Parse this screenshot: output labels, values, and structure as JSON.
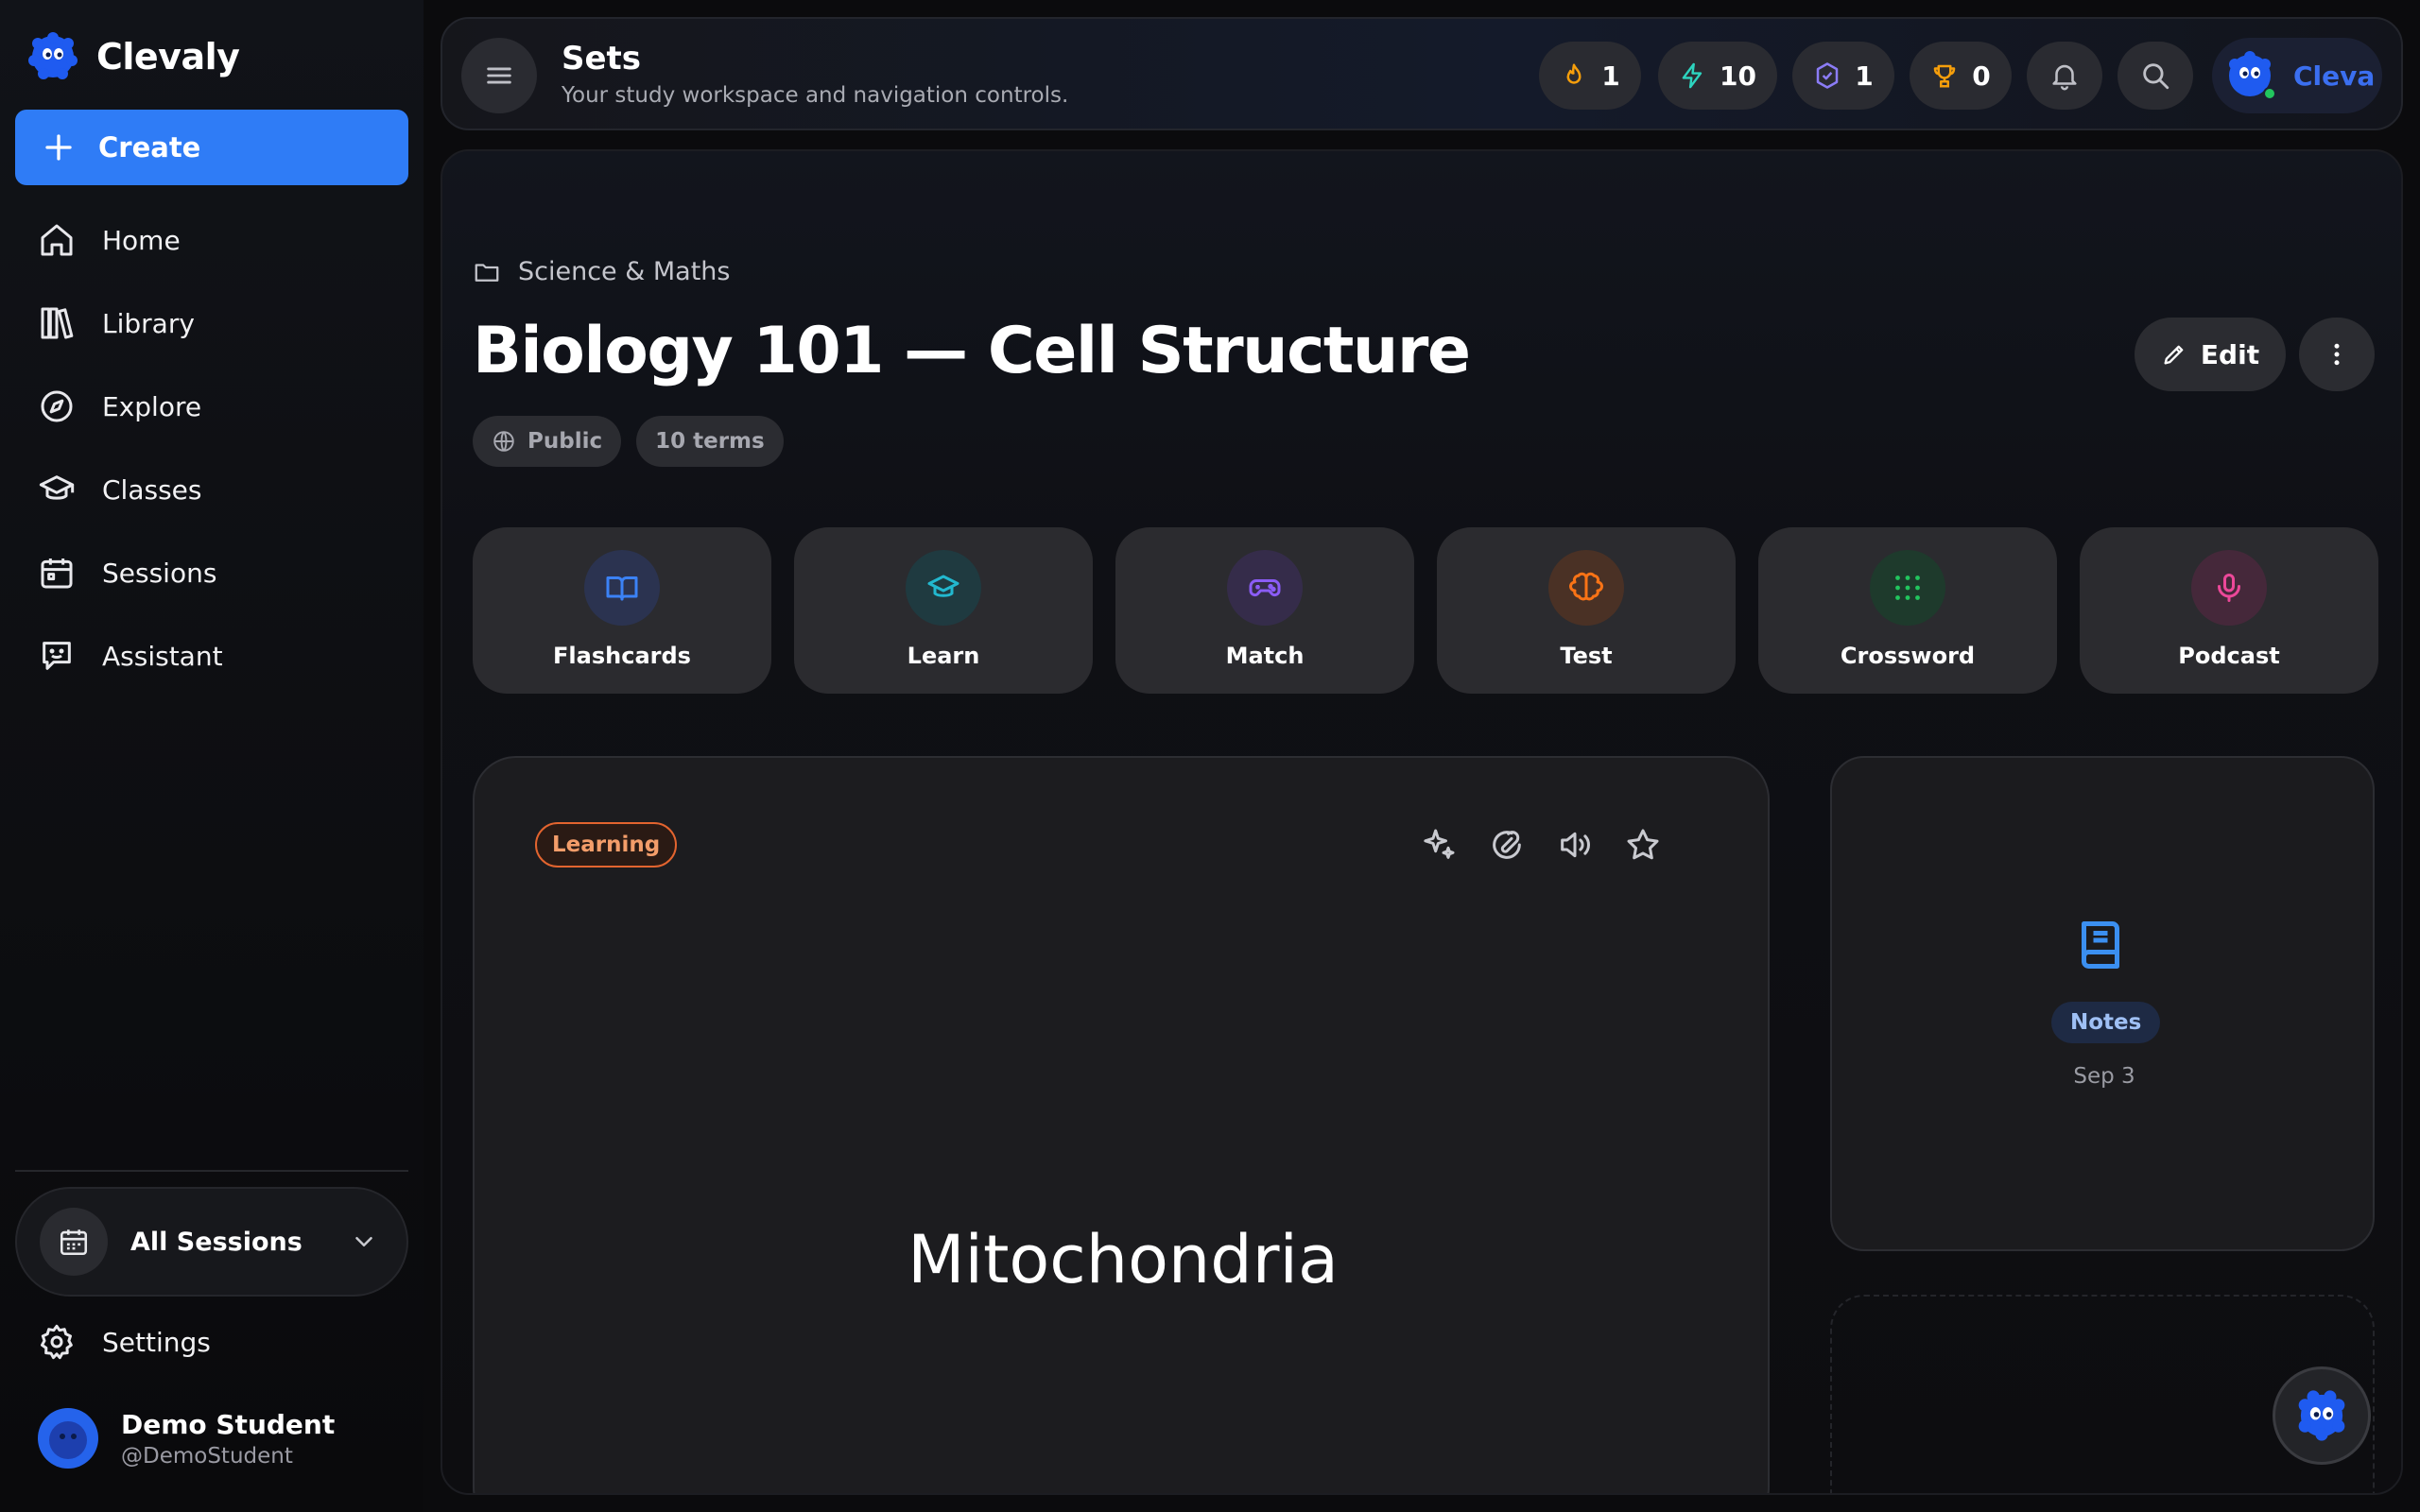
{
  "brand": {
    "name": "Clevaly"
  },
  "sidebar": {
    "create_label": "Create",
    "items": [
      {
        "label": "Home",
        "icon": "home-icon"
      },
      {
        "label": "Library",
        "icon": "library-icon"
      },
      {
        "label": "Explore",
        "icon": "compass-icon"
      },
      {
        "label": "Classes",
        "icon": "graduation-cap-icon"
      },
      {
        "label": "Sessions",
        "icon": "calendar-icon"
      },
      {
        "label": "Assistant",
        "icon": "chat-bot-icon"
      }
    ],
    "sessions_select": {
      "selected": "All Sessions"
    },
    "settings_label": "Settings",
    "user": {
      "name": "Demo Student",
      "handle": "@DemoStudent"
    }
  },
  "topbar": {
    "title": "Sets",
    "subtitle": "Your study workspace and navigation controls.",
    "stats": [
      {
        "icon": "flame-icon",
        "value": "1",
        "color": "#f59e0b"
      },
      {
        "icon": "lightning-icon",
        "value": "10",
        "color": "#2dd4bf"
      },
      {
        "icon": "badge-check-icon",
        "value": "1",
        "color": "#8b7cf6"
      },
      {
        "icon": "trophy-icon",
        "value": "0",
        "color": "#f59e0b"
      }
    ],
    "profile_name": "Cleva"
  },
  "set": {
    "breadcrumb": "Science & Maths",
    "title": "Biology 101 — Cell Structure",
    "visibility": "Public",
    "term_count": "10 terms",
    "edit_label": "Edit"
  },
  "modes": [
    {
      "label": "Flashcards",
      "icon": "book-open-icon",
      "color": "#3b82f6",
      "bg": "#2b3350"
    },
    {
      "label": "Learn",
      "icon": "graduation-cap-icon",
      "color": "#22b8cf",
      "bg": "#1f3a40"
    },
    {
      "label": "Match",
      "icon": "gamepad-icon",
      "color": "#8b5cf6",
      "bg": "#352c4a"
    },
    {
      "label": "Test",
      "icon": "brain-icon",
      "color": "#f97316",
      "bg": "#4a3125"
    },
    {
      "label": "Crossword",
      "icon": "grid-dots-icon",
      "color": "#22c55e",
      "bg": "#1e3a2c"
    },
    {
      "label": "Podcast",
      "icon": "microphone-icon",
      "color": "#ec4899",
      "bg": "#45283a"
    }
  ],
  "flashcard": {
    "status": "Learning",
    "term": "Mitochondria"
  },
  "notes": {
    "label": "Notes",
    "date": "Sep 3"
  }
}
